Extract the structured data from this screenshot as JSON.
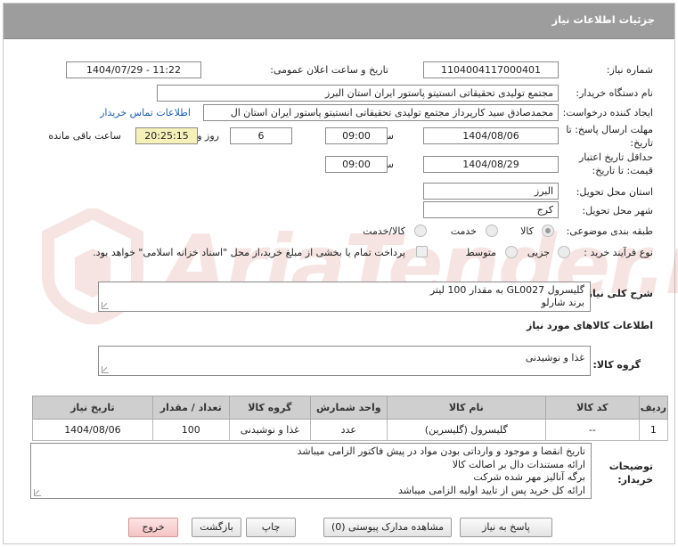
{
  "header": {
    "title": "جزئیات اطلاعات نیاز"
  },
  "form": {
    "need_number_label": "شماره نیاز:",
    "need_number": "1104004117000401",
    "announce_label": "تاریخ و ساعت اعلان عمومی:",
    "announce_value": "1404/07/29 - 11:22",
    "buyer_label": "نام دستگاه خریدار:",
    "buyer_value": "مجتمع تولیدی تحقیقاتی انستیتو پاستور ایران استان البرز",
    "creator_label": "ایجاد کننده درخواست:",
    "creator_value": "محمدصادق سید کارپرداز مجتمع تولیدی تحقیقاتی انستیتو پاستور ایران استان ال",
    "contact_link": "اطلاعات تماس خریدار",
    "deadline_label_1": "مهلت ارسال پاسخ: تا",
    "deadline_label_2": "تاریخ:",
    "deadline_date": "1404/08/06",
    "time_label": "ساعت",
    "deadline_time": "09:00",
    "days_value": "6",
    "days_label": "روز و",
    "remaining_value": "20:25:15",
    "remaining_label": "ساعت باقی مانده",
    "validity_label_1": "حداقل تاریخ اعتبار",
    "validity_label_2": "قیمت: تا تاریخ:",
    "validity_date": "1404/08/29",
    "validity_time": "09:00",
    "province_label": "استان محل تحویل:",
    "province_value": "البرز",
    "city_label": "شهر محل تحویل:",
    "city_value": "کرج",
    "category_label": "طبقه بندی موضوعی:",
    "category_options": [
      "کالا",
      "خدمت",
      "کالا/خدمت"
    ],
    "process_label": "نوع فرآیند خرید :",
    "process_options": [
      "جزیی",
      "متوسط"
    ],
    "payment_text": "پرداخت تمام یا بخشی از مبلغ خرید،از محل \"اسناد خزانه اسلامی\" خواهد بود."
  },
  "summary": {
    "label": "شرح کلی نیاز:",
    "line1": "گلیسرول GL0027 به مقدار 100 لیتر",
    "line2": "برند شارلو"
  },
  "goods_section_title": "اطلاعات کالاهای مورد نیاز",
  "goods_group": {
    "label": "گروه کالا:",
    "value": "غذا و نوشیدنی"
  },
  "table": {
    "headers": [
      "ردیف",
      "کد کالا",
      "نام کالا",
      "واحد شمارش",
      "گروه کالا",
      "تعداد / مقدار",
      "تاریخ نیاز"
    ],
    "rows": [
      [
        "1",
        "--",
        "گلیسرول (گلیسرین)",
        "عدد",
        "غذا و نوشیدنی",
        "100",
        "1404/08/06"
      ]
    ]
  },
  "notes": {
    "label_1": "توضیحات",
    "label_2": "خریدار:",
    "lines": [
      "تاریخ انقضا و موجود و وارداتی بودن مواد در پیش فاکتور الزامی میباشد",
      "ارائه مستندات دال بر اصالت کالا",
      "برگه آنالیز مهر شده شرکت",
      "ارائه کل خرید پس از تایید اولیه الزامی میباشد"
    ]
  },
  "buttons": {
    "reply": "پاسخ به نیاز",
    "attachments": "مشاهده مدارک پیوستی (0)",
    "print": "چاپ",
    "back": "بازگشت",
    "exit": "خروج"
  },
  "watermark": "AriaTender.net"
}
